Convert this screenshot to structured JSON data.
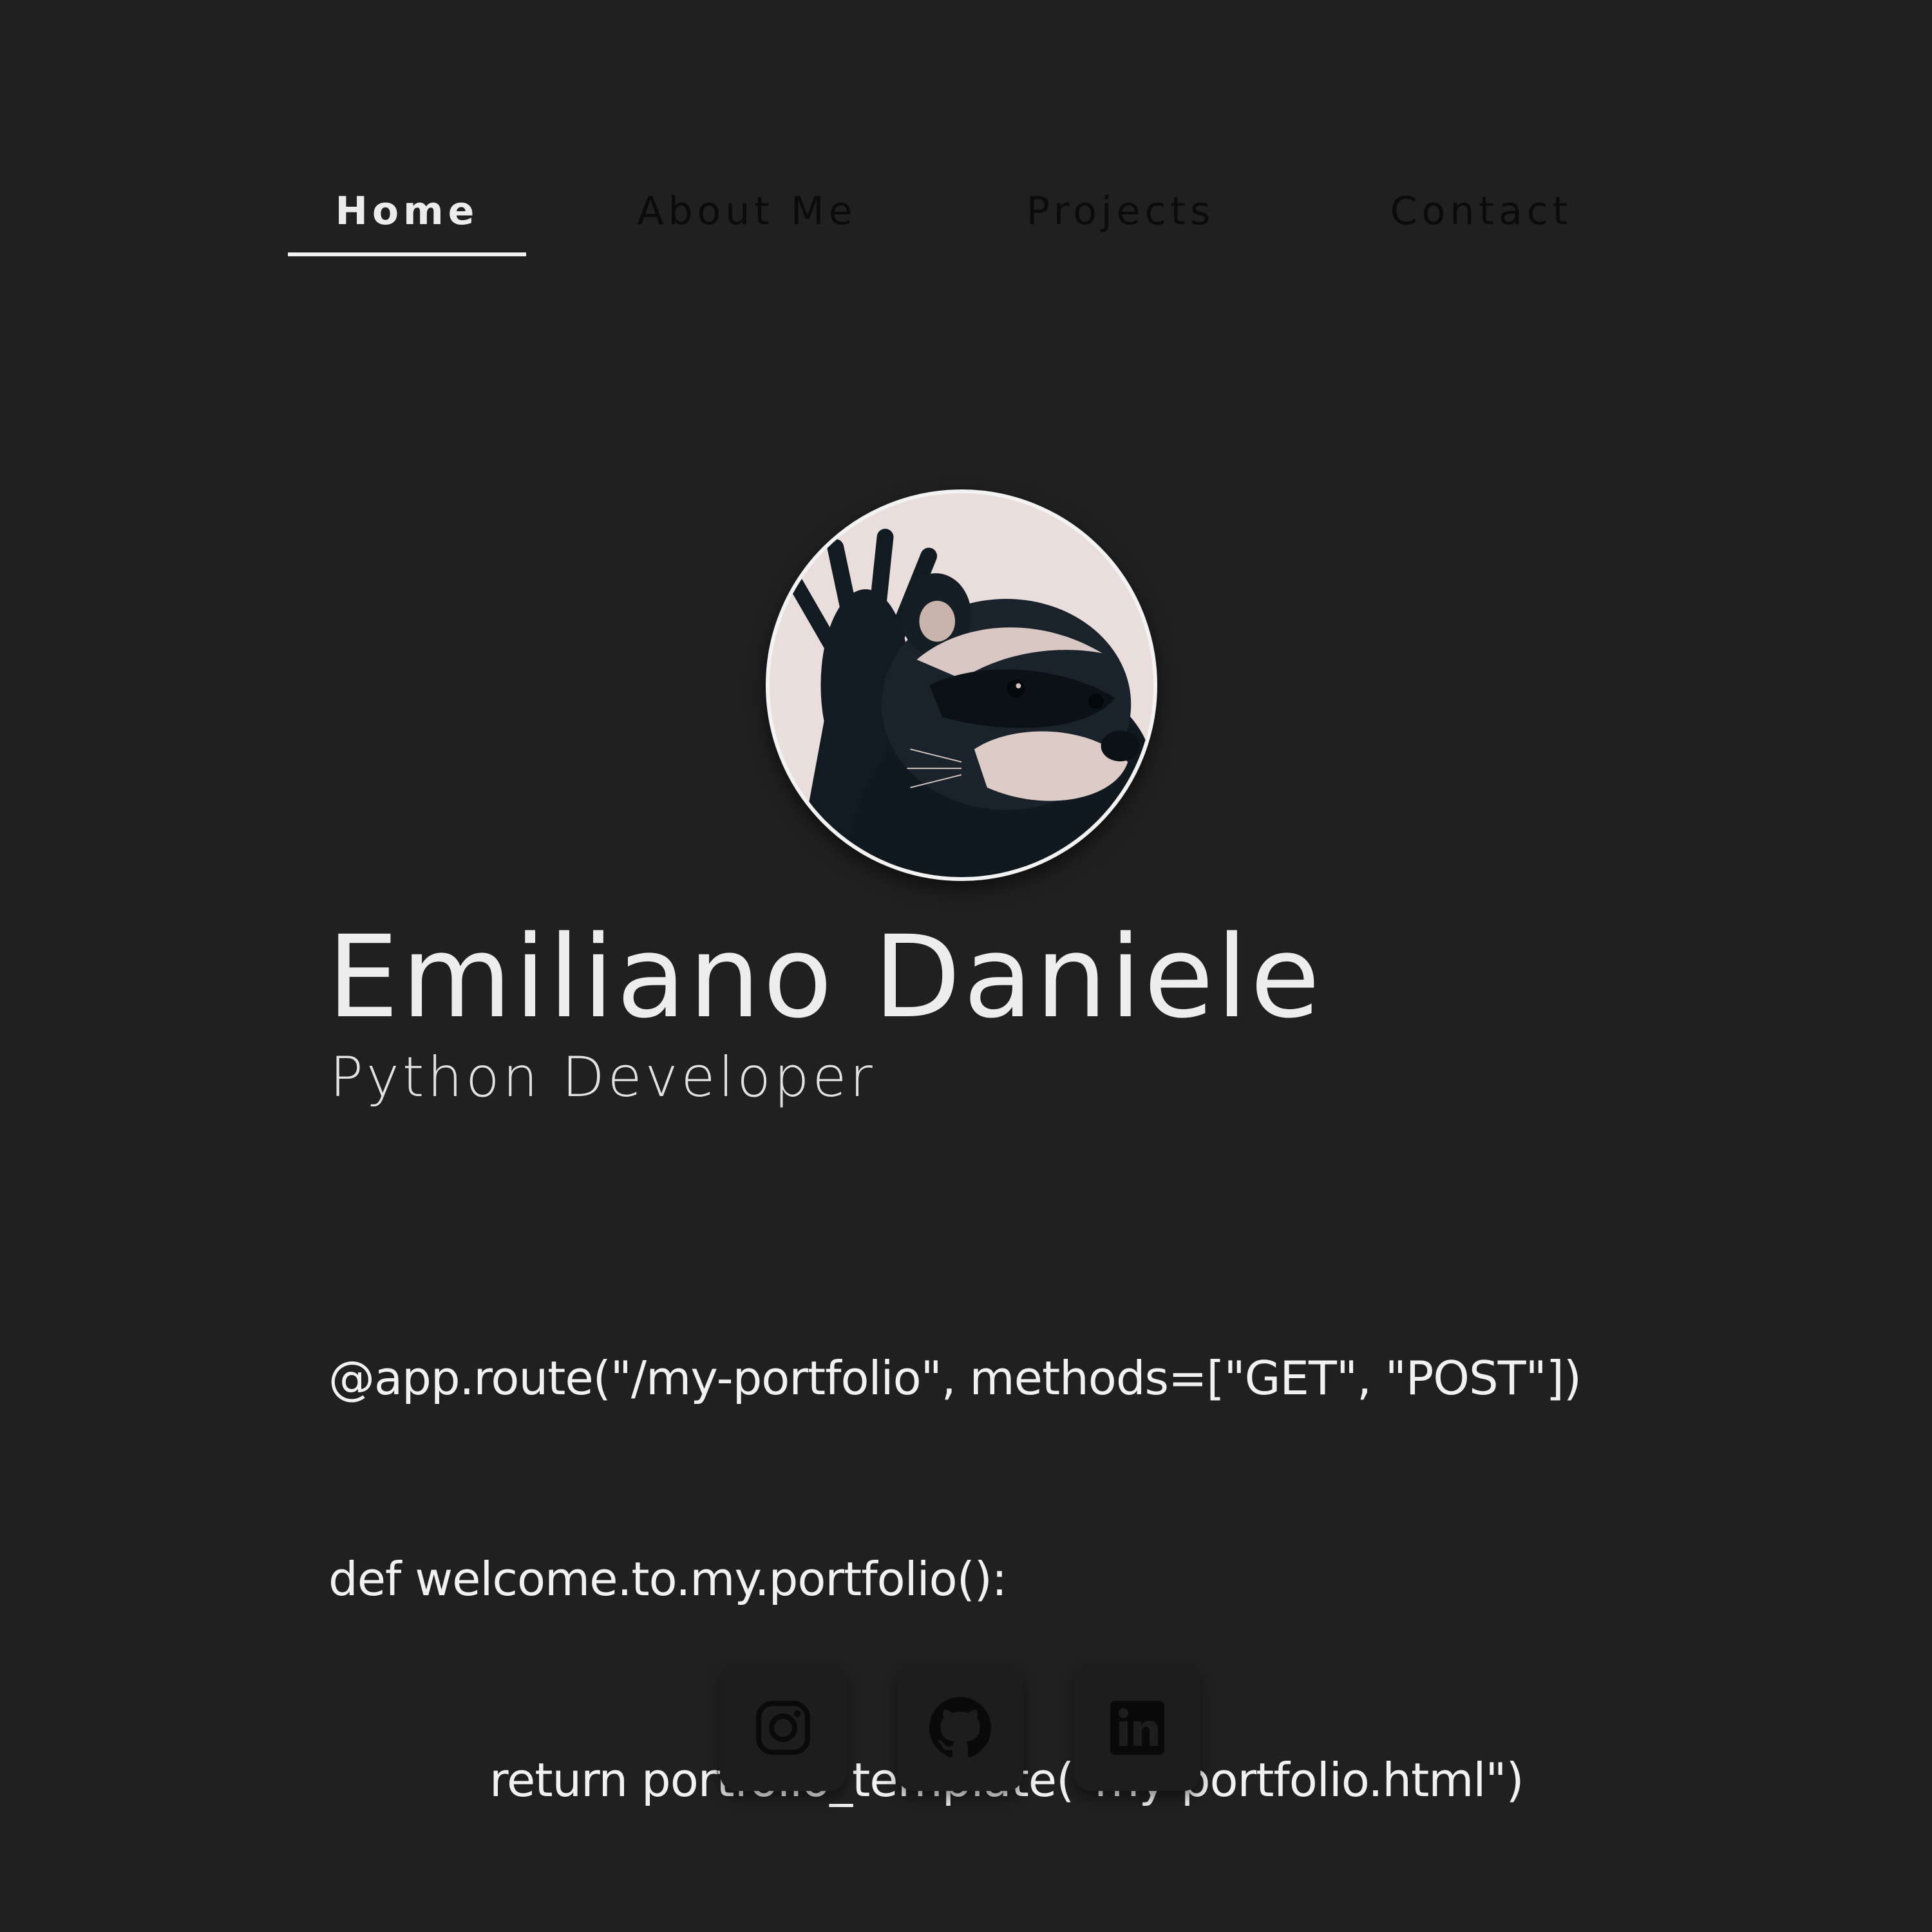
{
  "nav": {
    "items": [
      {
        "label": "Home",
        "active": true
      },
      {
        "label": "About Me",
        "active": false
      },
      {
        "label": "Projects",
        "active": false
      },
      {
        "label": "Contact",
        "active": false
      }
    ]
  },
  "profile": {
    "avatar_icon": "raccoon-waving-photo",
    "name": "Emiliano Daniele",
    "role": "Python Developer"
  },
  "code": {
    "line1": "@app.route(\"/my-portfolio\", methods=[\"GET\", \"POST\"])",
    "line2": "def welcome.to.my.portfolio():",
    "line3": "return portfolio_template(\"my-portfolio.html\")"
  },
  "social": [
    {
      "name": "instagram",
      "icon": "instagram-icon"
    },
    {
      "name": "github",
      "icon": "github-icon"
    },
    {
      "name": "linkedin",
      "icon": "linkedin-icon"
    }
  ],
  "colors": {
    "background": "#202020",
    "text": "#ededed",
    "nav_inactive": "#0b0b0b",
    "icon_dark": "#0a0a0a"
  }
}
